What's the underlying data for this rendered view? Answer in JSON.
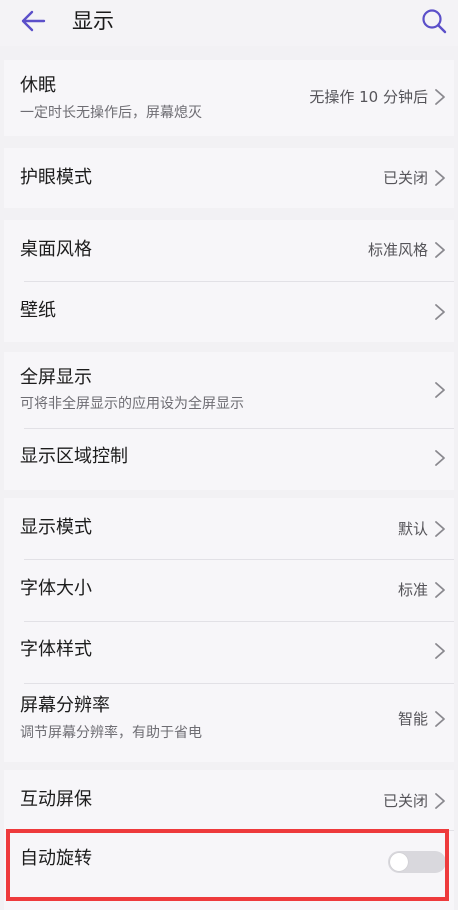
{
  "header": {
    "title": "显示"
  },
  "settings": {
    "sleep": {
      "title": "休眠",
      "subtitle": "一定时长无操作后，屏幕熄灭",
      "value": "无操作 10 分钟后"
    },
    "eye_comfort": {
      "title": "护眼模式",
      "value": "已关闭"
    },
    "home_style": {
      "title": "桌面风格",
      "value": "标准风格"
    },
    "wallpaper": {
      "title": "壁纸"
    },
    "full_screen": {
      "title": "全屏显示",
      "subtitle": "可将非全屏显示的应用设为全屏显示"
    },
    "display_area": {
      "title": "显示区域控制"
    },
    "display_mode": {
      "title": "显示模式",
      "value": "默认"
    },
    "font_size": {
      "title": "字体大小",
      "value": "标准"
    },
    "font_style": {
      "title": "字体样式"
    },
    "resolution": {
      "title": "屏幕分辨率",
      "subtitle": "调节屏幕分辨率，有助于省电",
      "value": "智能"
    },
    "screensaver": {
      "title": "互动屏保",
      "value": "已关闭"
    },
    "auto_rotate": {
      "title": "自动旋转",
      "enabled": false
    }
  },
  "colors": {
    "accent": "#5b4fc9",
    "highlight_border": "#ee3a3c"
  },
  "icons": {
    "back": "back-arrow-icon",
    "search": "search-icon",
    "chevron": "chevron-right-icon"
  }
}
